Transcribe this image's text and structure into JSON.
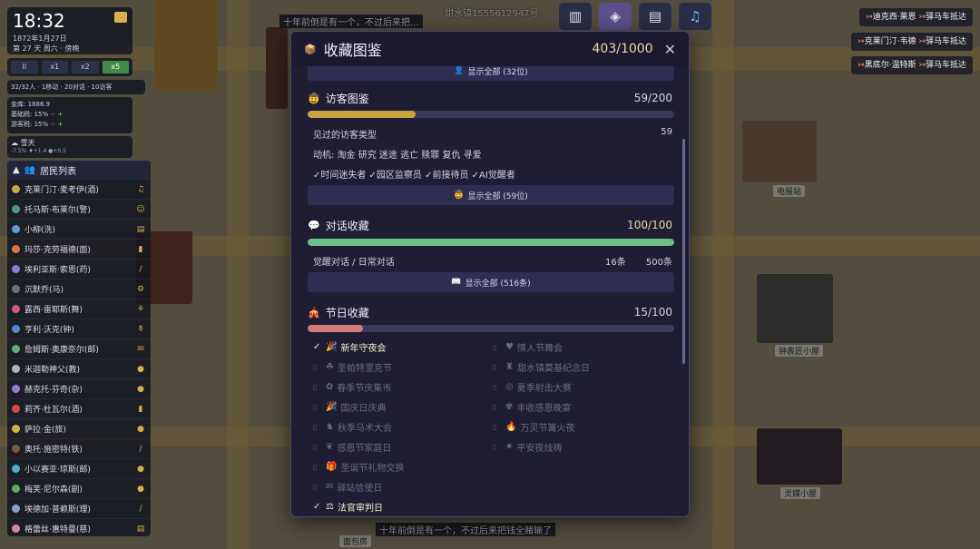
{
  "clock": {
    "time": "18:32",
    "date": "1872年1月27日",
    "week": "第 27 天 周六 · 傍晚"
  },
  "speed_controls": {
    "pause": "II",
    "x1": "x1",
    "x2": "x2",
    "x5": "x5",
    "active": "x5"
  },
  "stats_line": "32/32人 · 1移动 · 20对话 · 10访客",
  "treasury": {
    "gold": "金库: 1886.9",
    "tax1": "基础税: 15%",
    "tax2": "游客税: 15%",
    "minus": "−",
    "plus": "+"
  },
  "weather": {
    "label": "雪天",
    "sub": "-7.5% ♦+1.4 ●+0.5"
  },
  "roster": {
    "title": "居民列表",
    "residents": [
      {
        "name": "克莱门汀·麦考伊(酒)",
        "color": "#c9a24e",
        "icon": "♫"
      },
      {
        "name": "托马斯·布莱尔(警)",
        "color": "#4e9b7a",
        "icon": "☺"
      },
      {
        "name": "小柳(洗)",
        "color": "#5a9bd1",
        "icon": "▤"
      },
      {
        "name": "玛莎·克劳福德(面)",
        "color": "#d07a4a",
        "icon": "▮"
      },
      {
        "name": "埃利亚斯·索恩(药)",
        "color": "#8c7ad1",
        "icon": "/"
      },
      {
        "name": "沉默乔(马)",
        "color": "#6f6f6f",
        "icon": "⚙"
      },
      {
        "name": "露西·雷耶斯(舞)",
        "color": "#d15a7a",
        "icon": "⚘"
      },
      {
        "name": "亨利·沃克(钟)",
        "color": "#4a8dd1",
        "icon": "⚱"
      },
      {
        "name": "詹姆斯·奥康奈尔(邮)",
        "color": "#5ab07a",
        "icon": "✉"
      },
      {
        "name": "米迦勒神父(教)",
        "color": "#b0b0c8",
        "icon": "●"
      },
      {
        "name": "赫克托·芬奇(杂)",
        "color": "#9a7ad1",
        "icon": "●"
      },
      {
        "name": "莉齐·杜瓦尔(酒)",
        "color": "#d14a4a",
        "icon": "▮"
      },
      {
        "name": "萨拉·金(旅)",
        "color": "#d1b04a",
        "icon": "●"
      },
      {
        "name": "奥托·施密特(铁)",
        "color": "#7a5a3a",
        "icon": "/"
      },
      {
        "name": "小以赛亚·琼斯(邮)",
        "color": "#4ab0d1",
        "icon": "●"
      },
      {
        "name": "梅芙·尼尔森(剧)",
        "color": "#5ab05a",
        "icon": "●"
      },
      {
        "name": "埃德加·普赖斯(理)",
        "color": "#8aa0c8",
        "icon": "/"
      },
      {
        "name": "格蕾丝·惠特曼(慈)",
        "color": "#d18a9a",
        "icon": "▤"
      },
      {
        "name": "阿尔玛·桑切斯(灵)",
        "color": "#9a5ad1",
        "icon": "●"
      }
    ]
  },
  "notifications": [
    {
      "prefix": "迪克西·莱恩",
      "arrow": "↣",
      "suffix": "驿马车抵达"
    },
    {
      "prefix": "克莱门汀·韦德",
      "arrow": "↣",
      "suffix": "驿马车抵达"
    },
    {
      "prefix": "黑底尔·温特斯",
      "arrow": "↣",
      "suffix": "驿马车抵达"
    }
  ],
  "world": {
    "top_text": "十年前倒是有一个，不过后来把...",
    "bottom_text": "十年前倒是有一个，不过后来把钱全赌输了",
    "poster_text": "甜水镇1555612947号",
    "labels": {
      "telegraph": "电报站",
      "clock_house": "钟表匠小屋",
      "spirit_house": "灵媒小屋",
      "noodle": "面包房"
    }
  },
  "modal": {
    "title": "收藏图鉴",
    "total": "403/1000",
    "close": "✕",
    "top_button": "显示全部 (32位)",
    "visitors": {
      "title": "访客图鉴",
      "count": "59/200",
      "progress": 0.295,
      "types_label": "见过的访客类型",
      "types_count": "59",
      "motives": "动机: 淘金  研究  迷途  逃亡  赎罪  复仇  寻爱",
      "tags": "✓时间迷失者  ✓园区监察员  ✓前接待员  ✓AI觉醒者",
      "button": "显示全部 (59位)"
    },
    "dialogues": {
      "title": "对话收藏",
      "count": "100/100",
      "progress": 1.0,
      "sub_label": "觉醒对话 / 日常对话",
      "a": "16条",
      "b": "500条",
      "button": "显示全部 (516条)"
    },
    "festivals": {
      "title": "节日收藏",
      "count": "15/100",
      "progress": 0.15,
      "left": [
        {
          "name": "新年守夜会",
          "unlocked": true,
          "icon": "🎉"
        },
        {
          "name": "圣帕特里克节",
          "unlocked": false,
          "icon": "☘"
        },
        {
          "name": "春季节庆集市",
          "unlocked": false,
          "icon": "✿"
        },
        {
          "name": "国庆日庆典",
          "unlocked": false,
          "icon": "🎉"
        },
        {
          "name": "秋季马术大会",
          "unlocked": false,
          "icon": "♞"
        },
        {
          "name": "感恩节家庭日",
          "unlocked": false,
          "icon": "❦"
        },
        {
          "name": "圣诞节礼物交换",
          "unlocked": false,
          "icon": "🎁"
        },
        {
          "name": "驿站信使日",
          "unlocked": false,
          "icon": "✉"
        },
        {
          "name": "法官审判日",
          "unlocked": true,
          "icon": "⚖"
        }
      ],
      "right": [
        {
          "name": "情人节舞会",
          "unlocked": false,
          "icon": "♥"
        },
        {
          "name": "甜水镇奠基纪念日",
          "unlocked": false,
          "icon": "♜"
        },
        {
          "name": "夏季射击大赛",
          "unlocked": false,
          "icon": "◎"
        },
        {
          "name": "丰收感恩晚宴",
          "unlocked": false,
          "icon": "✾"
        },
        {
          "name": "万灵节篝火夜",
          "unlocked": false,
          "icon": "🔥"
        },
        {
          "name": "平安夜烛祷",
          "unlocked": false,
          "icon": "✷"
        }
      ]
    }
  },
  "colors": {
    "visitor_bar": "#c9a23f",
    "dialogue_bar": "#6dbf87",
    "festival_bar": "#d57a7a",
    "modal_bg": "#1e1d33"
  }
}
